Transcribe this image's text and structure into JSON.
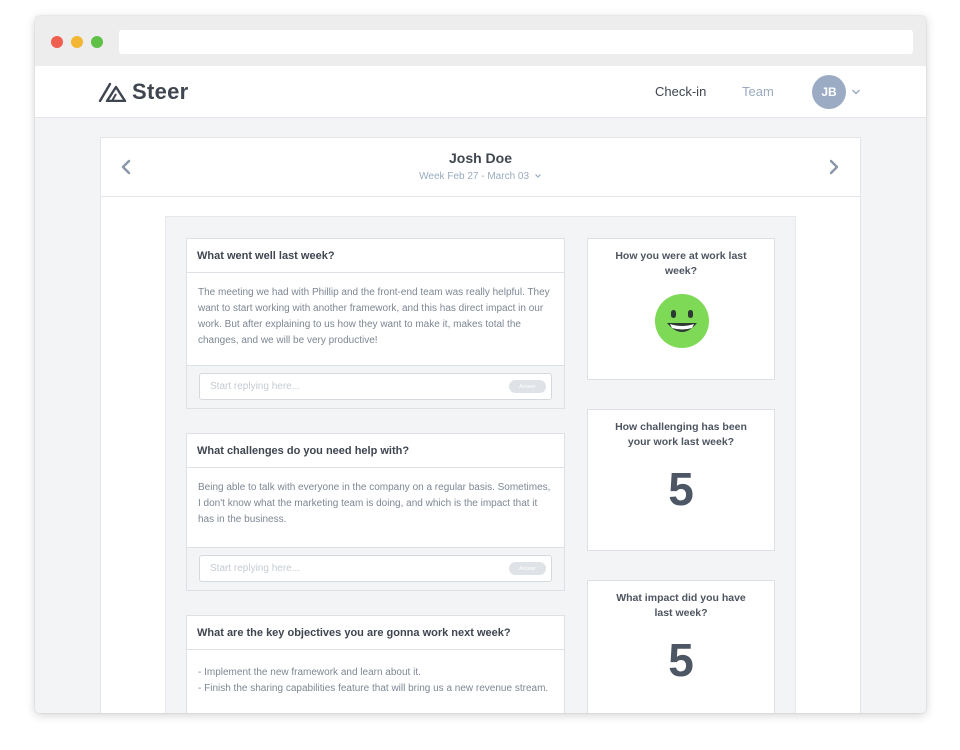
{
  "app": {
    "name": "Steer",
    "nav": {
      "checkin": "Check-in",
      "team": "Team"
    },
    "user_initials": "JB"
  },
  "checkin": {
    "person": "Josh Doe",
    "week": "Week Feb 27 - March 03"
  },
  "questions": [
    {
      "title": "What went well last week?",
      "answer": "The meeting we had with Phillip and the front-end team was really helpful. They want to start working with another framework, and this has direct impact in our work. But after explaining to us how they want to make it, makes total the changes, and we will be very productive!",
      "reply_placeholder": "Start replying here...",
      "reply_button": "Answer"
    },
    {
      "title": "What challenges do you need help with?",
      "answer": "Being able to talk with everyone in the company on a regular basis. Sometimes, I don't know what the marketing team is doing, and which is the impact that it has in the business.",
      "reply_placeholder": "Start replying here...",
      "reply_button": "Answer"
    },
    {
      "title": "What are the key objectives you are gonna work next week?",
      "answer_lines": [
        "- Implement the new framework and learn about it.",
        "- Finish the sharing capabilities feature that will bring us a new revenue stream."
      ]
    }
  ],
  "scores": [
    {
      "title": "How you were at work last week?",
      "type": "mood",
      "mood": "happy",
      "icon": "smiley-face-icon",
      "color": "#7ed957"
    },
    {
      "title": "How challenging has been your work last week?",
      "type": "number",
      "value": "5"
    },
    {
      "title": "What impact did you have last week?",
      "type": "number",
      "value": "5"
    }
  ]
}
